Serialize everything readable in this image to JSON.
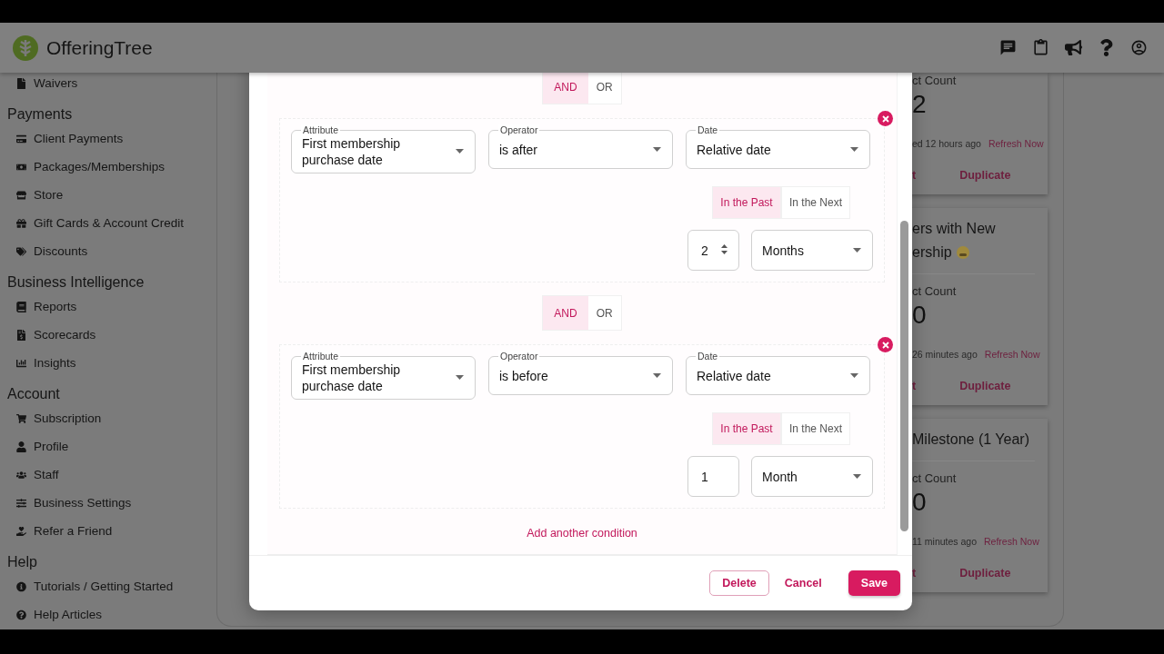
{
  "header": {
    "brand": "OfferingTree"
  },
  "sidebar": {
    "sections": [
      {
        "items": [
          "Waivers"
        ]
      },
      {
        "title": "Payments",
        "items": [
          "Client Payments",
          "Packages/Memberships",
          "Store",
          "Gift Cards & Account Credit",
          "Discounts"
        ]
      },
      {
        "title": "Business Intelligence",
        "items": [
          "Reports",
          "Scorecards",
          "Insights"
        ]
      },
      {
        "title": "Account",
        "items": [
          "Subscription",
          "Profile",
          "Staff",
          "Business Settings",
          "Refer a Friend"
        ]
      },
      {
        "title": "Help",
        "items": [
          "Tutorials / Getting Started",
          "Help Articles"
        ]
      }
    ]
  },
  "cards": [
    {
      "count_label": "ct Count",
      "count": "2",
      "updated": "ed 12 hours ago",
      "refresh": "Refresh Now",
      "actions": [
        "t",
        "Duplicate"
      ]
    },
    {
      "title_lines": [
        "ers with New",
        "ership"
      ],
      "emoji": true,
      "count_label": "ct Count",
      "count": "0",
      "updated": "26 minutes ago",
      "refresh": "Refresh Now",
      "actions": [
        "t",
        "Duplicate"
      ]
    },
    {
      "title_lines": [
        "Milestone (1 Year)"
      ],
      "emoji": false,
      "count_label": "ct Count",
      "count": "0",
      "updated": "11 minutes ago",
      "refresh": "Refresh Now",
      "actions": [
        "t",
        "Duplicate"
      ]
    }
  ],
  "modal": {
    "conditions": [
      {
        "connector": [
          {
            "label": "AND",
            "selected": true
          },
          {
            "label": "OR",
            "selected": false
          }
        ],
        "selects": [
          {
            "label": "Attribute",
            "value": "First membership purchase date"
          },
          {
            "label": "Operator",
            "value": "is after"
          },
          {
            "label": "Date",
            "value": "Relative date"
          }
        ],
        "direction": [
          {
            "label": "In the Past",
            "selected": true
          },
          {
            "label": "In the Next",
            "selected": false
          }
        ],
        "amount": {
          "value": "2",
          "stepper": true
        },
        "unit": "Months"
      },
      {
        "connector": [
          {
            "label": "AND",
            "selected": true
          },
          {
            "label": "OR",
            "selected": false
          }
        ],
        "selects": [
          {
            "label": "Attribute",
            "value": "First membership purchase date"
          },
          {
            "label": "Operator",
            "value": "is before"
          },
          {
            "label": "Date",
            "value": "Relative date"
          }
        ],
        "direction": [
          {
            "label": "In the Past",
            "selected": true
          },
          {
            "label": "In the Next",
            "selected": false
          }
        ],
        "amount": {
          "value": "1",
          "stepper": false
        },
        "unit": "Month"
      }
    ],
    "add_condition": "Add another condition",
    "buttons": [
      {
        "label": "Delete",
        "kind": "outline"
      },
      {
        "label": "Cancel",
        "kind": "text"
      },
      {
        "label": "Save",
        "kind": "primary"
      }
    ]
  }
}
